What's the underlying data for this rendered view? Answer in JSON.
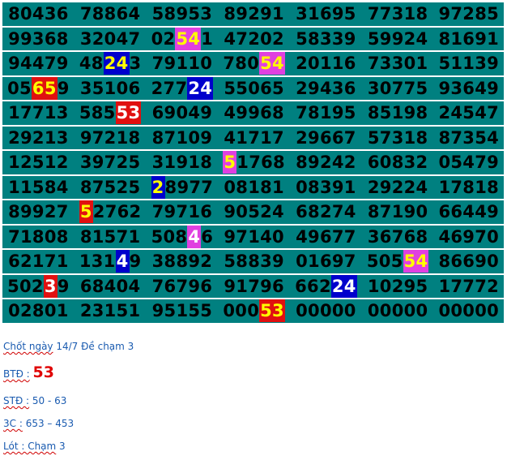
{
  "colors": {
    "cell_bg": "#008080",
    "digit": "#000000",
    "red_bg": "#e01010",
    "magenta_bg": "#e040e0",
    "blue_bg": "#0000cc",
    "yellow_text": "#ffff00",
    "white_text": "#ffffff",
    "note_text": "#1a5bb0",
    "note_accent": "#e00000"
  },
  "grid": {
    "rows": [
      [
        [
          "80436"
        ],
        [
          "78864"
        ],
        [
          "58953"
        ],
        [
          "89291"
        ],
        [
          "31695"
        ],
        [
          "77318"
        ],
        [
          "97285"
        ]
      ],
      [
        [
          "99368"
        ],
        [
          "32047"
        ],
        [
          "02",
          {
            "t": "54",
            "bg": "magenta",
            "fg": "yellow"
          },
          "1"
        ],
        [
          "47202"
        ],
        [
          "58339"
        ],
        [
          "59924"
        ],
        [
          "81691"
        ]
      ],
      [
        [
          "94479"
        ],
        [
          "48",
          {
            "t": "24",
            "bg": "blue",
            "fg": "yellow"
          },
          "3"
        ],
        [
          "79110"
        ],
        [
          "780",
          {
            "t": "54",
            "bg": "magenta",
            "fg": "yellow"
          }
        ],
        [
          "20116"
        ],
        [
          "73301"
        ],
        [
          "51139"
        ]
      ],
      [
        [
          "05",
          {
            "t": "65",
            "bg": "red",
            "fg": "yellow"
          },
          "9"
        ],
        [
          "35106"
        ],
        [
          "277",
          {
            "t": "24",
            "bg": "blue",
            "fg": "white"
          }
        ],
        [
          "55065"
        ],
        [
          "29436"
        ],
        [
          "30775"
        ],
        [
          "93649"
        ]
      ],
      [
        [
          "17713"
        ],
        [
          "585",
          {
            "t": "53",
            "bg": "red",
            "fg": "white"
          }
        ],
        [
          "69049"
        ],
        [
          "49968"
        ],
        [
          "78195"
        ],
        [
          "85198"
        ],
        [
          "24547"
        ]
      ],
      [
        [
          "29213"
        ],
        [
          "97218"
        ],
        [
          "87109"
        ],
        [
          "41717"
        ],
        [
          "29667"
        ],
        [
          "57318"
        ],
        [
          "87354"
        ]
      ],
      [
        [
          "12512"
        ],
        [
          "39725"
        ],
        [
          "31918"
        ],
        [
          {
            "t": "5",
            "bg": "magenta",
            "fg": "yellow"
          },
          "1768"
        ],
        [
          "89242"
        ],
        [
          "60832"
        ],
        [
          "05479"
        ]
      ],
      [
        [
          "11584"
        ],
        [
          "87525"
        ],
        [
          {
            "t": "2",
            "bg": "blue",
            "fg": "yellow"
          },
          "8977"
        ],
        [
          "08181"
        ],
        [
          "08391"
        ],
        [
          "29224"
        ],
        [
          "17818"
        ]
      ],
      [
        [
          "89927"
        ],
        [
          {
            "t": "5",
            "bg": "red",
            "fg": "yellow"
          },
          "2762"
        ],
        [
          "79716"
        ],
        [
          "90524"
        ],
        [
          "68274"
        ],
        [
          "87190"
        ],
        [
          "66449"
        ]
      ],
      [
        [
          "71808"
        ],
        [
          "81571"
        ],
        [
          "508",
          {
            "t": "4",
            "bg": "magenta",
            "fg": "white"
          },
          "6"
        ],
        [
          "97140"
        ],
        [
          "49677"
        ],
        [
          "36768"
        ],
        [
          "46970"
        ]
      ],
      [
        [
          "62171"
        ],
        [
          "131",
          {
            "t": "4",
            "bg": "blue",
            "fg": "white"
          },
          "9"
        ],
        [
          "38892"
        ],
        [
          "58839"
        ],
        [
          "01697"
        ],
        [
          "505",
          {
            "t": "54",
            "bg": "magenta",
            "fg": "yellow"
          }
        ],
        [
          "86690"
        ]
      ],
      [
        [
          "502",
          {
            "t": "3",
            "bg": "red",
            "fg": "white"
          },
          "9"
        ],
        [
          "68404"
        ],
        [
          "76796"
        ],
        [
          "91796"
        ],
        [
          "662",
          {
            "t": "24",
            "bg": "blue",
            "fg": "white"
          }
        ],
        [
          "10295"
        ],
        [
          "17772"
        ]
      ],
      [
        [
          "02801"
        ],
        [
          "23151"
        ],
        [
          "95155"
        ],
        [
          "000",
          {
            "t": "53",
            "bg": "red",
            "fg": "yellow"
          }
        ],
        [
          "00000"
        ],
        [
          "00000"
        ],
        [
          "00000"
        ]
      ]
    ]
  },
  "notes": {
    "line1": {
      "label": "Chốt ngày",
      "text": " 14/7 Đề chạm 3"
    },
    "line2": {
      "label": "BTĐ :",
      "value": "53"
    },
    "line3": {
      "label": "STĐ :",
      "text": " 50 - 63"
    },
    "line4": {
      "label": "3C :",
      "text": " 653  – 453"
    },
    "line5": {
      "label": "Lót : Chạm",
      "text": " 3"
    }
  }
}
